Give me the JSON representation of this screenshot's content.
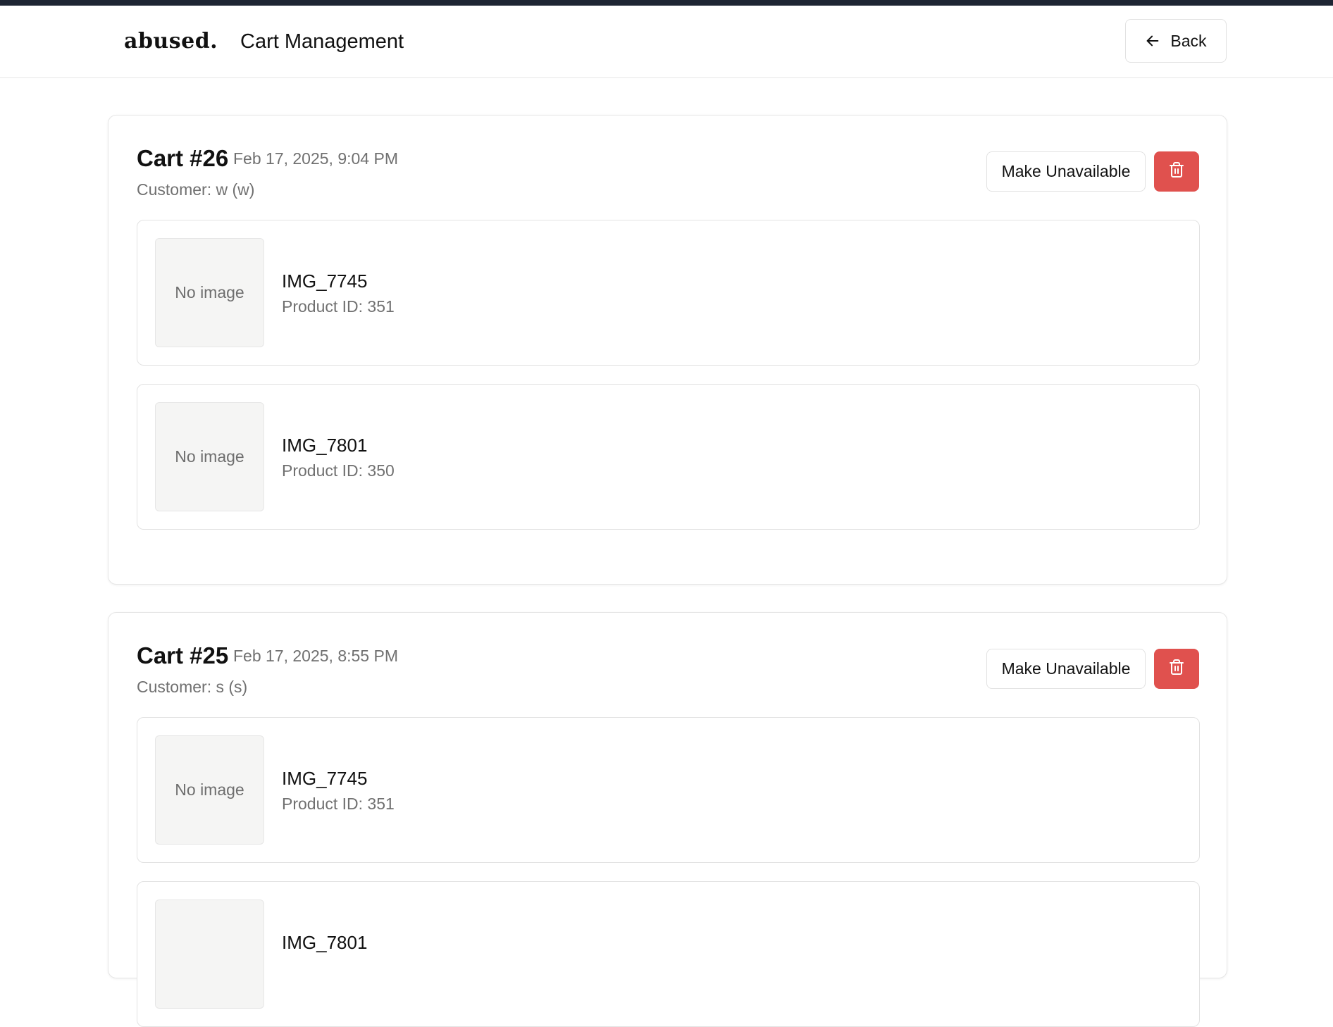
{
  "header": {
    "logo": "abused.",
    "title": "Cart Management",
    "back_label": "Back"
  },
  "colors": {
    "delete": "#e0514e",
    "topbar": "#1e2533"
  },
  "carts": [
    {
      "title": "Cart #26",
      "date": "Feb 17, 2025, 9:04 PM",
      "customer": "Customer: w (w)",
      "make_unavailable_label": "Make Unavailable",
      "delete_icon": "trash-icon",
      "items": [
        {
          "image_text": "No image",
          "name": "IMG_7745",
          "product_id": "Product ID: 351"
        },
        {
          "image_text": "No image",
          "name": "IMG_7801",
          "product_id": "Product ID: 350"
        }
      ]
    },
    {
      "title": "Cart #25",
      "date": "Feb 17, 2025, 8:55 PM",
      "customer": "Customer: s (s)",
      "make_unavailable_label": "Make Unavailable",
      "delete_icon": "trash-icon",
      "items": [
        {
          "image_text": "No image",
          "name": "IMG_7745",
          "product_id": "Product ID: 351"
        },
        {
          "image_text": "",
          "name": "IMG_7801",
          "product_id": ""
        }
      ]
    }
  ]
}
